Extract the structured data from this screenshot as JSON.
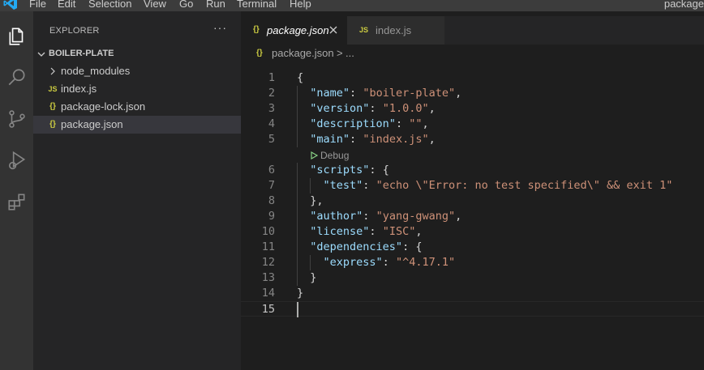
{
  "menubar": {
    "items": [
      "File",
      "Edit",
      "Selection",
      "View",
      "Go",
      "Run",
      "Terminal",
      "Help"
    ],
    "window_title": "package"
  },
  "activity_bar": {
    "icons": [
      "files-icon",
      "search-icon",
      "source-control-icon",
      "run-debug-icon",
      "extensions-icon"
    ]
  },
  "sidebar": {
    "title": "EXPLORER",
    "more_actions": "···",
    "folder": "BOILER-PLATE",
    "items": [
      {
        "label": "node_modules",
        "type": "folder",
        "icon": ""
      },
      {
        "label": "index.js",
        "type": "js",
        "icon": "JS"
      },
      {
        "label": "package-lock.json",
        "type": "json",
        "icon": "{}"
      },
      {
        "label": "package.json",
        "type": "json",
        "icon": "{}",
        "selected": true
      }
    ]
  },
  "tabs": [
    {
      "label": "package.json",
      "icon": "{}",
      "active": true
    },
    {
      "label": "index.js",
      "icon": "JS",
      "active": false
    }
  ],
  "breadcrumb": {
    "icon": "{}",
    "file": "package.json",
    "separator": ">",
    "more": "..."
  },
  "editor": {
    "codelens": "Debug",
    "current_line": 15,
    "lines": [
      {
        "n": "1",
        "t": "{"
      },
      {
        "n": "2",
        "t": "  \"name\": \"boiler-plate\","
      },
      {
        "n": "3",
        "t": "  \"version\": \"1.0.0\","
      },
      {
        "n": "4",
        "t": "  \"description\": \"\","
      },
      {
        "n": "5",
        "t": "  \"main\": \"index.js\","
      },
      {
        "n": "6",
        "t": "  \"scripts\": {"
      },
      {
        "n": "7",
        "t": "    \"test\": \"echo \\\"Error: no test specified\\\" && exit 1\""
      },
      {
        "n": "8",
        "t": "  },"
      },
      {
        "n": "9",
        "t": "  \"author\": \"yang-gwang\","
      },
      {
        "n": "10",
        "t": "  \"license\": \"ISC\","
      },
      {
        "n": "11",
        "t": "  \"dependencies\": {"
      },
      {
        "n": "12",
        "t": "    \"express\": \"^4.17.1\""
      },
      {
        "n": "13",
        "t": "  }"
      },
      {
        "n": "14",
        "t": "}"
      },
      {
        "n": "15",
        "t": ""
      }
    ]
  },
  "colors": {
    "accent": "#007acc",
    "json_key": "#9cdcfe",
    "json_string": "#ce9178",
    "file_icon": "#cbcb41"
  }
}
